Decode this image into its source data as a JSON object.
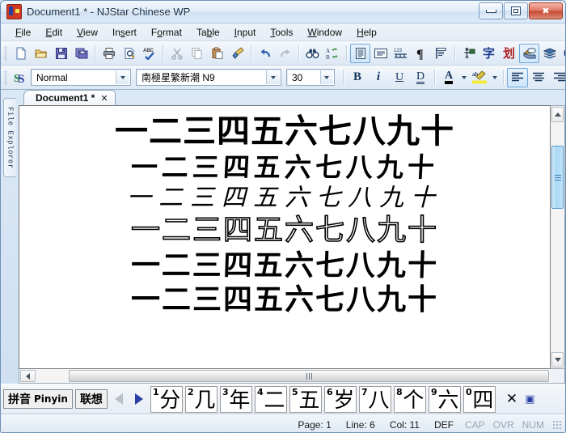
{
  "window": {
    "title": "Document1 * - NJStar Chinese WP",
    "app_icon": "njstar-app-icon",
    "minimize": "–",
    "maximize": "□",
    "close": "✕"
  },
  "menu": {
    "items": [
      {
        "label": "File",
        "accel": "F"
      },
      {
        "label": "Edit",
        "accel": "E"
      },
      {
        "label": "View",
        "accel": "V"
      },
      {
        "label": "Insert",
        "accel": "s"
      },
      {
        "label": "Format",
        "accel": "o"
      },
      {
        "label": "Table",
        "accel": "b"
      },
      {
        "label": "Input",
        "accel": "I"
      },
      {
        "label": "Tools",
        "accel": "T"
      },
      {
        "label": "Window",
        "accel": "W"
      },
      {
        "label": "Help",
        "accel": "H"
      }
    ]
  },
  "toolbar": {
    "buttons": [
      {
        "name": "new-document",
        "icon": "new-page-icon"
      },
      {
        "name": "open-document",
        "icon": "open-folder-icon"
      },
      {
        "name": "save-document",
        "icon": "save-disk-icon"
      },
      {
        "name": "save-as",
        "icon": "save-as-icon"
      },
      {
        "name": "print",
        "icon": "printer-icon"
      },
      {
        "name": "print-preview",
        "icon": "print-preview-icon"
      },
      {
        "name": "spell-check",
        "icon": "abc-check-icon"
      },
      {
        "name": "cut",
        "icon": "scissors-icon"
      },
      {
        "name": "copy",
        "icon": "copy-icon"
      },
      {
        "name": "paste",
        "icon": "clipboard-paste-icon"
      },
      {
        "name": "format-painter",
        "icon": "paintbrush-icon"
      },
      {
        "name": "undo",
        "icon": "undo-arrow-icon"
      },
      {
        "name": "redo",
        "icon": "redo-arrow-icon"
      },
      {
        "name": "find",
        "icon": "binoculars-icon"
      },
      {
        "name": "replace",
        "icon": "replace-ab-icon"
      },
      {
        "name": "page-layout-view",
        "icon": "page-view-icon"
      },
      {
        "name": "normal-view",
        "icon": "normal-view-icon"
      },
      {
        "name": "show-ruler",
        "icon": "ruler-123-icon"
      },
      {
        "name": "paragraph-marks",
        "icon": "pilcrow-icon"
      },
      {
        "name": "columns",
        "icon": "columns-icon"
      },
      {
        "name": "insert-person",
        "icon": "person-icon"
      },
      {
        "name": "chinese-char",
        "icon": "zi-character-icon",
        "label": "字"
      },
      {
        "name": "stroke-input",
        "icon": "hua-character-icon",
        "label": "划"
      },
      {
        "name": "annotation",
        "icon": "speech-bubble-icon"
      },
      {
        "name": "dictionary",
        "icon": "book-icon"
      },
      {
        "name": "about-info",
        "icon": "info-circle-icon"
      }
    ]
  },
  "format_toolbar": {
    "style_icon": "style-ss-icon",
    "style_value": "Normal",
    "font_value": "南極星繁新潮 N9",
    "size_value": "30",
    "bold_label": "B",
    "italic_label": "i",
    "underline_label": "U",
    "double_underline_label": "D",
    "font_color_label": "A",
    "highlight_label": "ab",
    "align_left": "align-left-icon",
    "align_center": "align-center-icon",
    "align_right": "align-right-icon",
    "align_justify": "align-justify-icon"
  },
  "sidebar": {
    "file_explorer_label": "File Explorer"
  },
  "document": {
    "tab_label": "Document1 *",
    "tab_close": "✕",
    "lines": [
      "一二三四五六七八九十",
      "一二三四五六七八九十",
      "一二三四五六七八九十",
      "一二三四五六七八九十",
      "一二三四五六七八九十",
      "一二三四五六七八九十"
    ]
  },
  "ime": {
    "method_cn": "拼音",
    "method_en": "Pinyin",
    "assoc_label": "联想",
    "prev_icon": "prev-page-arrow-icon",
    "next_icon": "next-page-arrow-icon",
    "close_label": "✕",
    "candidates": [
      {
        "num": "1",
        "char": "分"
      },
      {
        "num": "2",
        "char": "几"
      },
      {
        "num": "3",
        "char": "年"
      },
      {
        "num": "4",
        "char": "二"
      },
      {
        "num": "5",
        "char": "五"
      },
      {
        "num": "6",
        "char": "岁"
      },
      {
        "num": "7",
        "char": "八"
      },
      {
        "num": "8",
        "char": "个"
      },
      {
        "num": "9",
        "char": "六"
      },
      {
        "num": "0",
        "char": "四"
      }
    ]
  },
  "status": {
    "page": "Page: 1",
    "line": "Line: 6",
    "col": "Col: 11",
    "mode": "DEF",
    "cap": "CAP",
    "ovr": "OVR",
    "num": "NUM"
  },
  "colors": {
    "accent": "#6ea8dc",
    "title_text": "#183048",
    "close_button": "#c64a34",
    "scrollbar_thumb": "#a9d8f6"
  }
}
